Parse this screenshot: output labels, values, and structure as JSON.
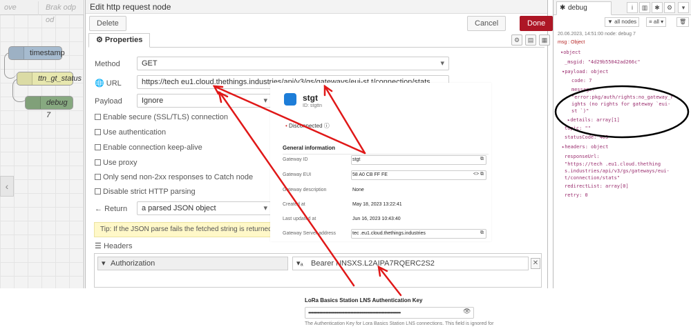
{
  "canvas": {
    "tabs": [
      "ove",
      "Brak odp od"
    ],
    "nodes": [
      "timestamp",
      "ttn_gt_status",
      "debug 7"
    ]
  },
  "dialog": {
    "title": "Edit http request node",
    "delete_label": "Delete",
    "cancel_label": "Cancel",
    "done_label": "Done",
    "tab_properties": "Properties",
    "method_label": "Method",
    "method_value": "GET",
    "url_label": "URL",
    "url_value": "https://tech        eu1.cloud.thethings.industries/api/v3/gs/gateways/eui-st     t/connection/stats",
    "payload_label": "Payload",
    "payload_value": "Ignore",
    "checks": [
      "Enable secure (SSL/TLS) connection",
      "Use authentication",
      "Enable connection keep-alive",
      "Use proxy",
      "Only send non-2xx responses to Catch node",
      "Disable strict HTTP parsing"
    ],
    "return_label": "Return",
    "return_value": "a parsed JSON object",
    "tip": "Tip: If the JSON parse fails the fetched string is returned as-is.",
    "headers_label": "Headers",
    "header_key": "Authorization",
    "header_value": "Bearer NNSXS.L2AIPA7RQERC2S2"
  },
  "ttn": {
    "title": "stgt",
    "id": "ID: stgttn",
    "status": "Disconnected",
    "section": "General information",
    "rows": [
      {
        "label": "Gateway ID",
        "value": "stgt"
      },
      {
        "label": "Gateway EUI",
        "value": "58 A0 CB FF FE"
      },
      {
        "label": "Gateway description",
        "value": "None"
      },
      {
        "label": "Created at",
        "value": "May 18, 2023 13:22:41"
      },
      {
        "label": "Last updated at",
        "value": "Jun 16, 2023 10:43:40"
      },
      {
        "label": "Gateway Server address",
        "value": "tec      .eu1.cloud.thethings.industries"
      }
    ]
  },
  "debug": {
    "tab_label": "debug",
    "filter_nodes": "all nodes",
    "filter_all": "all",
    "timestamp": "20.06.2023, 14:51:00   node: debug 7",
    "msg_type": "msg : Object",
    "lines": [
      "▾object",
      "_msgid: \"4d29b55042ad266c\"",
      "▾payload: object",
      "code: 7",
      "message:",
      "\"error:pkg/auth/rights:no_gateway_r",
      "ights (no rights for gateway `eui-",
      "st              `)\"",
      "▸details: array[1]",
      "topic: \"\"",
      "statusCode: 403",
      "▸headers: object",
      "responseUrl:",
      "\"https://tech      .eu1.cloud.thething",
      "s.industries/api/v3/gs/gateways/eui-",
      "      t/connection/stats\"",
      "redirectList: array[0]",
      "retry: 0"
    ]
  },
  "auth": {
    "label": "LoRa Basics Station LNS Authentication Key",
    "value": "••••••••••••••••••••••••••••••••••••••••••••••••••••••••••••••••••••••••••",
    "desc": "The Authentication Key for Lora Basics Station LNS connections. This field is ignored for"
  },
  "colors": {
    "accent_red": "#e01818",
    "done_button": "#ad1625",
    "ttn_blue": "#1d7dd8"
  }
}
